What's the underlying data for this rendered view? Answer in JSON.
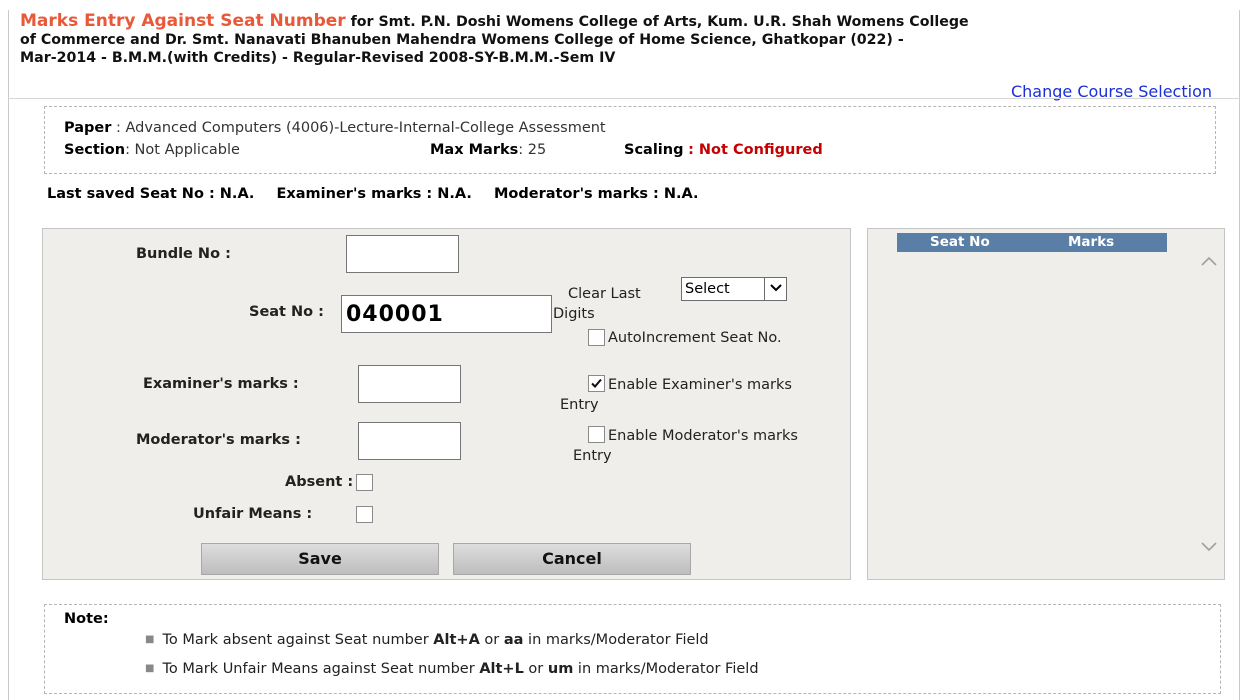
{
  "header": {
    "title": "Marks Entry Against Seat Number",
    "line1": " for Smt. P.N. Doshi Womens College of Arts, Kum. U.R. Shah Womens College",
    "line2": "of Commerce and Dr. Smt. Nanavati Bhanuben Mahendra Womens College of Home Science, Ghatkopar (022) -",
    "line3": "Mar-2014 - B.M.M.(with Credits) - Regular-Revised 2008-SY-B.M.M.-Sem IV"
  },
  "change_course_link": "Change Course Selection",
  "paper": {
    "paper_label": "Paper",
    "paper_value": ": Advanced Computers (4006)-Lecture-Internal-College Assessment",
    "section_label": "Section",
    "section_value": ": Not Applicable",
    "max_marks_label": "Max Marks",
    "max_marks_value": ": 25",
    "scaling_label": "Scaling",
    "scaling_value": ": Not Configured"
  },
  "last_saved": {
    "seat": "Last saved Seat No : N.A.",
    "examiner": "Examiner's marks : N.A.",
    "moderator": "Moderator's marks : N.A."
  },
  "form": {
    "bundle_label": "Bundle No :",
    "bundle_value": "",
    "seat_label": "Seat No :",
    "seat_value": "040001",
    "clear_last_label": "Clear Last",
    "digits_label": "Digits",
    "clear_select_value": "Select",
    "auto_increment_label": "AutoIncrement Seat No.",
    "auto_increment_checked": false,
    "examiner_label": "Examiner's marks :",
    "examiner_value": "",
    "enable_examiner_label": "Enable Examiner's marks",
    "enable_examiner_label2": "Entry",
    "enable_examiner_checked": true,
    "moderator_label": "Moderator's marks :",
    "moderator_value": "",
    "enable_moderator_label": "Enable Moderator's marks",
    "enable_moderator_label2": "Entry",
    "enable_moderator_checked": false,
    "absent_label": "Absent :",
    "absent_checked": false,
    "unfair_label": "Unfair Means :",
    "unfair_checked": false,
    "save_label": "Save",
    "cancel_label": "Cancel"
  },
  "list": {
    "col_seat": "Seat No",
    "col_marks": "Marks",
    "rows": []
  },
  "note": {
    "title": "Note:",
    "item1_pre": "To Mark absent against Seat number ",
    "item1_k1": "Alt+A",
    "item1_mid": " or ",
    "item1_k2": "aa",
    "item1_post": " in marks/Moderator Field",
    "item2_pre": "To Mark Unfair Means against Seat number ",
    "item2_k1": "Alt+L",
    "item2_mid": " or ",
    "item2_k2": "um",
    "item2_post": " in marks/Moderator Field"
  },
  "colors": {
    "title_orange": "#e8593a",
    "link_blue": "#1a2fd6",
    "not_configured_red": "#c40000",
    "list_header_blue": "#5a7fa6",
    "panel_bg": "#f0eeea"
  },
  "icons": {
    "dropdown": "chevron-down-icon",
    "checkmark": "checkmark-icon",
    "scroll_up": "chevron-up-icon",
    "scroll_down": "chevron-down-icon"
  }
}
